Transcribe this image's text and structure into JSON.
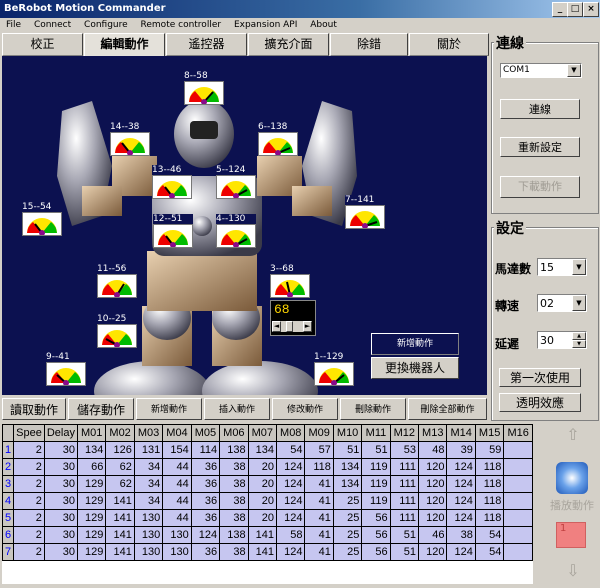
{
  "window": {
    "title": "BeRobot Motion Commander",
    "min": "_",
    "max": "□",
    "close": "×"
  },
  "menu": [
    "File",
    "Connect",
    "Configure",
    "Remote controller",
    "Expansion API",
    "About"
  ],
  "tabs": [
    "校正",
    "編輯動作",
    "遙控器",
    "擴充介面",
    "除錯",
    "關於"
  ],
  "active_tab": 1,
  "gauges": [
    {
      "label": "8--58"
    },
    {
      "label": "14--38"
    },
    {
      "label": "6--138"
    },
    {
      "label": "13--46"
    },
    {
      "label": "5--124"
    },
    {
      "label": "15--54"
    },
    {
      "label": "7--141"
    },
    {
      "label": "12--51"
    },
    {
      "label": "4--130"
    },
    {
      "label": "11--56"
    },
    {
      "label": "3--68"
    },
    {
      "label": "10--25"
    },
    {
      "label": "9--41"
    },
    {
      "label": "1--129"
    }
  ],
  "edit_value": "68",
  "view_buttons": {
    "add": "新增動作",
    "change": "更換機器人"
  },
  "actions": [
    "讀取動作",
    "儲存動作",
    "新增動作",
    "插入動作",
    "修改動作",
    "刪除動作",
    "刪除全部動作"
  ],
  "table": {
    "headers": [
      "Spee",
      "Delay",
      "M01",
      "M02",
      "M03",
      "M04",
      "M05",
      "M06",
      "M07",
      "M08",
      "M09",
      "M10",
      "M11",
      "M12",
      "M13",
      "M14",
      "M15",
      "M16"
    ],
    "rows": [
      [
        "1",
        "2",
        "30",
        "134",
        "126",
        "131",
        "154",
        "114",
        "138",
        "134",
        "54",
        "57",
        "51",
        "51",
        "53",
        "48",
        "39",
        "59",
        ""
      ],
      [
        "2",
        "2",
        "30",
        "66",
        "62",
        "34",
        "44",
        "36",
        "38",
        "20",
        "124",
        "118",
        "134",
        "119",
        "111",
        "120",
        "124",
        "118",
        ""
      ],
      [
        "3",
        "2",
        "30",
        "129",
        "62",
        "34",
        "44",
        "36",
        "38",
        "20",
        "124",
        "41",
        "134",
        "119",
        "111",
        "120",
        "124",
        "118",
        ""
      ],
      [
        "4",
        "2",
        "30",
        "129",
        "141",
        "34",
        "44",
        "36",
        "38",
        "20",
        "124",
        "41",
        "25",
        "119",
        "111",
        "120",
        "124",
        "118",
        ""
      ],
      [
        "5",
        "2",
        "30",
        "129",
        "141",
        "130",
        "44",
        "36",
        "38",
        "20",
        "124",
        "41",
        "25",
        "56",
        "111",
        "120",
        "124",
        "118",
        ""
      ],
      [
        "6",
        "2",
        "30",
        "129",
        "141",
        "130",
        "130",
        "124",
        "138",
        "141",
        "58",
        "41",
        "25",
        "56",
        "51",
        "46",
        "38",
        "54",
        ""
      ],
      [
        "7",
        "2",
        "30",
        "129",
        "141",
        "130",
        "130",
        "36",
        "38",
        "141",
        "124",
        "41",
        "25",
        "56",
        "51",
        "120",
        "124",
        "54",
        ""
      ]
    ]
  },
  "connect": {
    "title": "連線",
    "port": "COM1",
    "connect_btn": "連線",
    "reset_btn": "重新設定",
    "download_btn": "下載動作"
  },
  "settings": {
    "title": "設定",
    "motor_label": "馬達數",
    "motor_value": "15",
    "speed_label": "轉速",
    "speed_value": "02",
    "delay_label": "延遲",
    "delay_value": "30",
    "first_use_btn": "第一次使用",
    "transparency_btn": "透明效應"
  },
  "play": {
    "label": "播放動作",
    "value": "1"
  },
  "colors": {
    "view_bg": "#0c1150",
    "row_bg": "#c6c6f0",
    "titlebar": "#0a246a"
  }
}
